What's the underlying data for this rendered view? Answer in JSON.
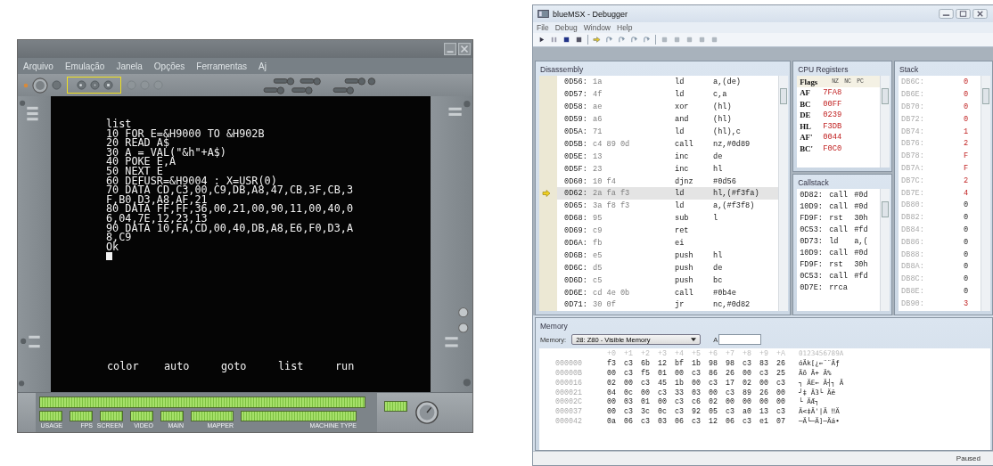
{
  "emulator": {
    "menu": [
      "Arquivo",
      "Emulação",
      "Janela",
      "Opções",
      "Ferramentas",
      "Aj"
    ],
    "screen_lines": [
      "list",
      "10 FOR E=&H9000 TO &H902B",
      "20 READ A$",
      "30 A = VAL(\"&h\"+A$)",
      "40 POKE E,A",
      "50 NEXT E",
      "60 DEFUSR=&H9004 : X=USR(0)",
      "70 DATA CD,C3,00,C9,DB,A8,47,CB,3F,CB,3",
      "F,B0,D3,A8,AF,21",
      "80 DATA FF,FF,36,00,21,00,90,11,00,40,0",
      "6,04,7E,12,23,13",
      "90 DATA 10,FA,CD,00,40,DB,A8,E6,F0,D3,A",
      "8,C9",
      "Ok"
    ],
    "function_keys": [
      "color",
      "auto",
      "goto",
      "list",
      "run"
    ],
    "status_labels": [
      "USAGE",
      "FPS",
      "SCREEN",
      "VIDEO",
      "MAIN",
      "MAPPER",
      "MACHINE TYPE"
    ]
  },
  "debugger": {
    "window": {
      "title": "blueMSX - Debugger"
    },
    "menu": [
      "File",
      "Debug",
      "Window",
      "Help"
    ],
    "disassembly": {
      "title": "Disassembly",
      "rows": [
        {
          "address": "0D56:",
          "bytes": "1a",
          "mnemonic": "ld",
          "operands": "a,(de)",
          "current": false
        },
        {
          "address": "0D57:",
          "bytes": "4f",
          "mnemonic": "ld",
          "operands": "c,a",
          "current": false
        },
        {
          "address": "0D58:",
          "bytes": "ae",
          "mnemonic": "xor",
          "operands": "(hl)",
          "current": false
        },
        {
          "address": "0D59:",
          "bytes": "a6",
          "mnemonic": "and",
          "operands": "(hl)",
          "current": false
        },
        {
          "address": "0D5A:",
          "bytes": "71",
          "mnemonic": "ld",
          "operands": "(hl),c",
          "current": false
        },
        {
          "address": "0D5B:",
          "bytes": "c4 89 0d",
          "mnemonic": "call",
          "operands": "nz,#0d89",
          "current": false
        },
        {
          "address": "0D5E:",
          "bytes": "13",
          "mnemonic": "inc",
          "operands": "de",
          "current": false
        },
        {
          "address": "0D5F:",
          "bytes": "23",
          "mnemonic": "inc",
          "operands": "hl",
          "current": false
        },
        {
          "address": "0D60:",
          "bytes": "10 f4",
          "mnemonic": "djnz",
          "operands": "#0d56",
          "current": false
        },
        {
          "address": "0D62:",
          "bytes": "2a fa f3",
          "mnemonic": "ld",
          "operands": "hl,(#f3fa)",
          "current": true
        },
        {
          "address": "0D65:",
          "bytes": "3a f8 f3",
          "mnemonic": "ld",
          "operands": "a,(#f3f8)",
          "current": false
        },
        {
          "address": "0D68:",
          "bytes": "95",
          "mnemonic": "sub",
          "operands": "l",
          "current": false
        },
        {
          "address": "0D69:",
          "bytes": "c9",
          "mnemonic": "ret",
          "operands": "",
          "current": false
        },
        {
          "address": "0D6A:",
          "bytes": "fb",
          "mnemonic": "ei",
          "operands": "",
          "current": false
        },
        {
          "address": "0D6B:",
          "bytes": "e5",
          "mnemonic": "push",
          "operands": "hl",
          "current": false
        },
        {
          "address": "0D6C:",
          "bytes": "d5",
          "mnemonic": "push",
          "operands": "de",
          "current": false
        },
        {
          "address": "0D6D:",
          "bytes": "c5",
          "mnemonic": "push",
          "operands": "bc",
          "current": false
        },
        {
          "address": "0D6E:",
          "bytes": "cd 4e 0b",
          "mnemonic": "call",
          "operands": "#0b4e",
          "current": false
        },
        {
          "address": "0D71:",
          "bytes": "30 0f",
          "mnemonic": "jr",
          "operands": "nc,#0d82",
          "current": false
        }
      ]
    },
    "cpu_registers": {
      "title": "CPU Registers",
      "flags_label": "Flags",
      "flags": [
        "NZ",
        "NC",
        "PC"
      ],
      "rows": [
        {
          "name": "AF",
          "value": "7FA8"
        },
        {
          "name": "BC",
          "value": "00FF"
        },
        {
          "name": "DE",
          "value": "0239"
        },
        {
          "name": "HL",
          "value": "F3DB"
        },
        {
          "name": "AF'",
          "value": "0044"
        },
        {
          "name": "BC'",
          "value": "F0C0"
        }
      ]
    },
    "callstack": {
      "title": "Callstack",
      "rows": [
        {
          "address": "0D82:",
          "op": "call",
          "target": "#0d"
        },
        {
          "address": "10D9:",
          "op": "call",
          "target": "#0d"
        },
        {
          "address": "FD9F:",
          "op": "rst",
          "target": "30h"
        },
        {
          "address": "0C53:",
          "op": "call",
          "target": "#fd"
        },
        {
          "address": "0D73:",
          "op": "ld",
          "target": "a,("
        },
        {
          "address": "10D9:",
          "op": "call",
          "target": "#0d"
        },
        {
          "address": "FD9F:",
          "op": "rst",
          "target": "30h"
        },
        {
          "address": "0C53:",
          "op": "call",
          "target": "#fd"
        },
        {
          "address": "0D7E:",
          "op": "rrca",
          "target": ""
        }
      ]
    },
    "stack": {
      "title": "Stack",
      "rows": [
        {
          "address": "DB6C:",
          "value": "0",
          "changed": true
        },
        {
          "address": "DB6E:",
          "value": "0",
          "changed": true
        },
        {
          "address": "DB70:",
          "value": "0",
          "changed": true
        },
        {
          "address": "DB72:",
          "value": "0",
          "changed": true
        },
        {
          "address": "DB74:",
          "value": "1",
          "changed": true
        },
        {
          "address": "DB76:",
          "value": "2",
          "changed": true
        },
        {
          "address": "DB78:",
          "value": "F",
          "changed": true
        },
        {
          "address": "DB7A:",
          "value": "F",
          "changed": true
        },
        {
          "address": "DB7C:",
          "value": "2",
          "changed": true
        },
        {
          "address": "DB7E:",
          "value": "4",
          "changed": true
        },
        {
          "address": "DB80:",
          "value": "0",
          "changed": false
        },
        {
          "address": "DB82:",
          "value": "0",
          "changed": false
        },
        {
          "address": "DB84:",
          "value": "0",
          "changed": false
        },
        {
          "address": "DB86:",
          "value": "0",
          "changed": false
        },
        {
          "address": "DB88:",
          "value": "0",
          "changed": false
        },
        {
          "address": "DB8A:",
          "value": "0",
          "changed": false
        },
        {
          "address": "DB8C:",
          "value": "0",
          "changed": false
        },
        {
          "address": "DB8E:",
          "value": "0",
          "changed": false
        },
        {
          "address": "DB90:",
          "value": "3",
          "changed": true
        }
      ]
    },
    "memory": {
      "title": "Memory",
      "selector_label": "Memory:",
      "selector_value": "28: Z80 - Visible Memory",
      "address_label": "A",
      "columns": [
        "+0",
        "+1",
        "+2",
        "+3",
        "+4",
        "+5",
        "+6",
        "+7",
        "+8",
        "+9",
        "+A"
      ],
      "ascii_header": "0123456789A",
      "rows": [
        {
          "address": "000000",
          "bytes": [
            "f3",
            "c3",
            "6b",
            "12",
            "bf",
            "1b",
            "98",
            "98",
            "c3",
            "83",
            "26"
          ],
          "ascii": "óÄk[¿←¨¨Äƒ"
        },
        {
          "address": "00000B",
          "bytes": [
            "00",
            "c3",
            "f5",
            "01",
            "00",
            "c3",
            "86",
            "26",
            "00",
            "c3",
            "25"
          ],
          "ascii": "Äõ Ä+ Ä%"
        },
        {
          "address": "000016",
          "bytes": [
            "02",
            "00",
            "c3",
            "45",
            "1b",
            "00",
            "c3",
            "17",
            "02",
            "00",
            "c3"
          ],
          "ascii": "┐ ÄE← Ä┤┐ Ä"
        },
        {
          "address": "000021",
          "bytes": [
            "04",
            "0c",
            "00",
            "c3",
            "33",
            "03",
            "00",
            "c3",
            "89",
            "26",
            "00"
          ],
          "ascii": "┘‡ Ä3└ Äë"
        },
        {
          "address": "00002C",
          "bytes": [
            "00",
            "03",
            "01",
            "00",
            "c3",
            "c6",
            "02",
            "00",
            "00",
            "00",
            "00"
          ],
          "ascii": "└ ÄÆ┐"
        },
        {
          "address": "000037",
          "bytes": [
            "00",
            "c3",
            "3c",
            "0c",
            "c3",
            "92",
            "05",
            "c3",
            "a0",
            "13",
            "c3"
          ],
          "ascii": "Ä<‡Ä'|Ä ‼Ä"
        },
        {
          "address": "000042",
          "bytes": [
            "0a",
            "06",
            "c3",
            "03",
            "06",
            "c3",
            "12",
            "06",
            "c3",
            "e1",
            "07"
          ],
          "ascii": "─Ä└─Ä]─Äá•"
        }
      ]
    },
    "status_bar": {
      "text": "Paused"
    }
  }
}
